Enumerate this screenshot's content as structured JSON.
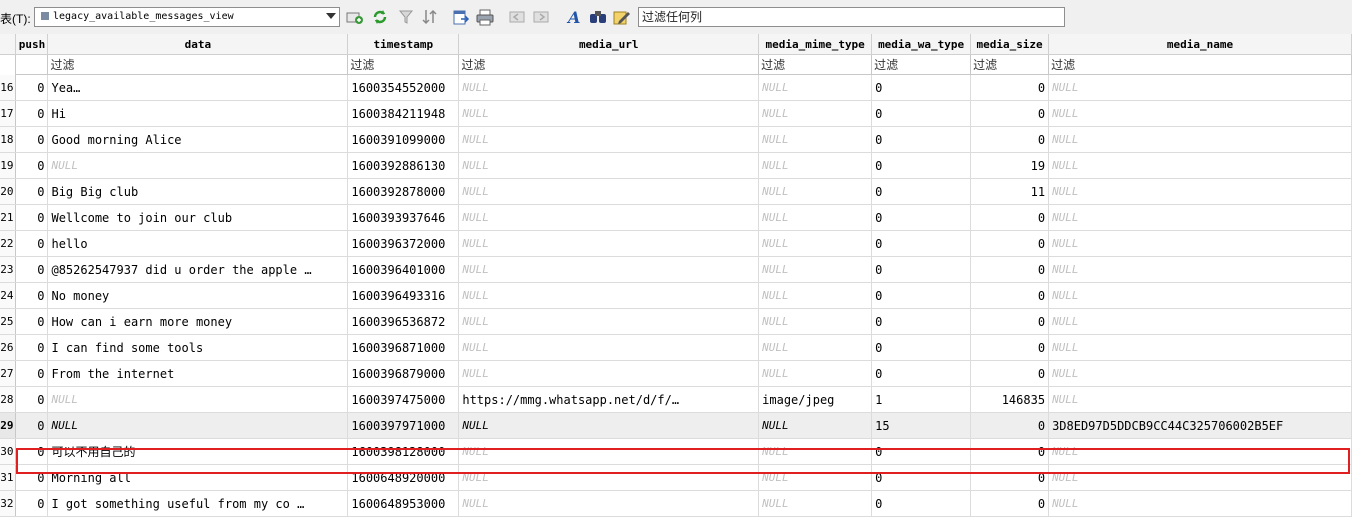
{
  "toolbar": {
    "table_label": "表(T):",
    "table_select": "legacy_available_messages_view",
    "filter_placeholder": "过滤任何列"
  },
  "columns": [
    "push",
    "data",
    "timestamp",
    "media_url",
    "media_mime_type",
    "media_wa_type",
    "media_size",
    "media_name"
  ],
  "filter_text": "过滤",
  "rows": [
    {
      "n": "16",
      "push": "0",
      "data": "Yea…",
      "timestamp": "1600354552000",
      "media_url": "NULL",
      "mime": "NULL",
      "wa_type": "0",
      "size": "0",
      "name": "NULL"
    },
    {
      "n": "17",
      "push": "0",
      "data": "Hi",
      "timestamp": "1600384211948",
      "media_url": "NULL",
      "mime": "NULL",
      "wa_type": "0",
      "size": "0",
      "name": "NULL"
    },
    {
      "n": "18",
      "push": "0",
      "data": "Good morning Alice",
      "timestamp": "1600391099000",
      "media_url": "NULL",
      "mime": "NULL",
      "wa_type": "0",
      "size": "0",
      "name": "NULL"
    },
    {
      "n": "19",
      "push": "0",
      "data": "NULL",
      "timestamp": "1600392886130",
      "media_url": "NULL",
      "mime": "NULL",
      "wa_type": "0",
      "size": "19",
      "name": "NULL"
    },
    {
      "n": "20",
      "push": "0",
      "data": "Big Big club",
      "timestamp": "1600392878000",
      "media_url": "NULL",
      "mime": "NULL",
      "wa_type": "0",
      "size": "11",
      "name": "NULL"
    },
    {
      "n": "21",
      "push": "0",
      "data": "Wellcome to join our club",
      "timestamp": "1600393937646",
      "media_url": "NULL",
      "mime": "NULL",
      "wa_type": "0",
      "size": "0",
      "name": "NULL"
    },
    {
      "n": "22",
      "push": "0",
      "data": "hello",
      "timestamp": "1600396372000",
      "media_url": "NULL",
      "mime": "NULL",
      "wa_type": "0",
      "size": "0",
      "name": "NULL"
    },
    {
      "n": "23",
      "push": "0",
      "data": "@85262547937 did u order the apple …",
      "timestamp": "1600396401000",
      "media_url": "NULL",
      "mime": "NULL",
      "wa_type": "0",
      "size": "0",
      "name": "NULL"
    },
    {
      "n": "24",
      "push": "0",
      "data": "No money",
      "timestamp": "1600396493316",
      "media_url": "NULL",
      "mime": "NULL",
      "wa_type": "0",
      "size": "0",
      "name": "NULL"
    },
    {
      "n": "25",
      "push": "0",
      "data": "How can i earn more money",
      "timestamp": "1600396536872",
      "media_url": "NULL",
      "mime": "NULL",
      "wa_type": "0",
      "size": "0",
      "name": "NULL"
    },
    {
      "n": "26",
      "push": "0",
      "data": "I can find some tools",
      "timestamp": "1600396871000",
      "media_url": "NULL",
      "mime": "NULL",
      "wa_type": "0",
      "size": "0",
      "name": "NULL"
    },
    {
      "n": "27",
      "push": "0",
      "data": "From the internet",
      "timestamp": "1600396879000",
      "media_url": "NULL",
      "mime": "NULL",
      "wa_type": "0",
      "size": "0",
      "name": "NULL"
    },
    {
      "n": "28",
      "push": "0",
      "data": "NULL",
      "timestamp": "1600397475000",
      "media_url": "https://mmg.whatsapp.net/d/f/…",
      "mime": "image/jpeg",
      "wa_type": "1",
      "size": "146835",
      "name": "NULL"
    },
    {
      "n": "29",
      "push": "0",
      "data": "NULL",
      "timestamp": "1600397971000",
      "media_url": "NULL",
      "mime": "NULL",
      "wa_type": "15",
      "size": "0",
      "name": "3D8ED97D5DDCB9CC44C325706002B5EF",
      "selected": true
    },
    {
      "n": "30",
      "push": "0",
      "data": "可以不用自己的",
      "timestamp": "1600398128000",
      "media_url": "NULL",
      "mime": "NULL",
      "wa_type": "0",
      "size": "0",
      "name": "NULL"
    },
    {
      "n": "31",
      "push": "0",
      "data": "Morning all",
      "timestamp": "1600648920000",
      "media_url": "NULL",
      "mime": "NULL",
      "wa_type": "0",
      "size": "0",
      "name": "NULL"
    },
    {
      "n": "32",
      "push": "0",
      "data": "I got something useful from my co …",
      "timestamp": "1600648953000",
      "media_url": "NULL",
      "mime": "NULL",
      "wa_type": "0",
      "size": "0",
      "name": "NULL"
    }
  ],
  "icons": [
    "new-record-icon",
    "refresh-icon",
    "clear-filter-icon",
    "sort-icon",
    "export-icon",
    "print-icon",
    "prev-page-icon",
    "next-page-icon",
    "font-icon",
    "binoculars-icon",
    "edit-icon"
  ]
}
